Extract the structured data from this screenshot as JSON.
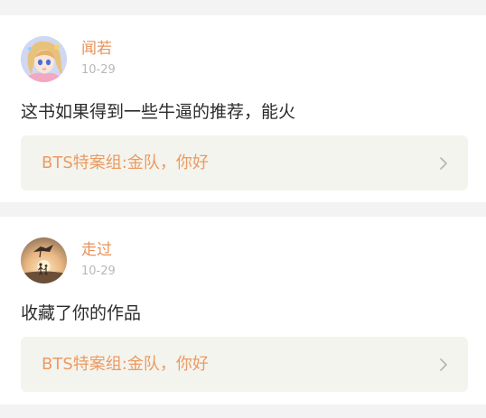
{
  "comments": [
    {
      "author": "闻若",
      "date": "10-29",
      "avatar_icon": "anime-girl-avatar",
      "text": "这书如果得到一些牛逼的推荐，能火",
      "reply": {
        "text": "BTS特案组:金队，你好",
        "icon": "chevron-right-icon"
      }
    },
    {
      "author": "走过",
      "date": "10-29",
      "avatar_icon": "sunset-couple-avatar",
      "text": "收藏了你的作品",
      "reply": {
        "text": "BTS特案组:金队，你好",
        "icon": "chevron-right-icon"
      }
    }
  ],
  "colors": {
    "accent": "#e8935a",
    "reply_background": "#f4f4ee",
    "page_background": "#f3f3f3"
  }
}
